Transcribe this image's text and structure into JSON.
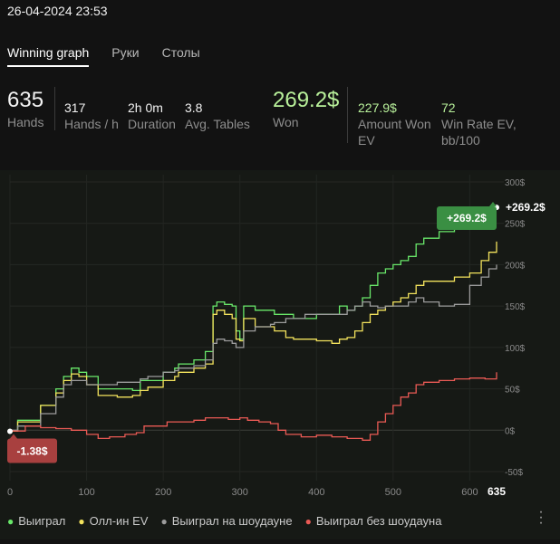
{
  "timestamp": "26-04-2024 23:53",
  "tabs": [
    {
      "label": "Winning graph",
      "active": true
    },
    {
      "label": "Руки",
      "active": false
    },
    {
      "label": "Столы",
      "active": false
    }
  ],
  "stats": {
    "hands": {
      "value": "635",
      "label": "Hands"
    },
    "hands_per_hour": {
      "value": "317",
      "label": "Hands / h"
    },
    "duration": {
      "value": "2h 0m",
      "label": "Duration"
    },
    "avg_tables": {
      "value": "3.8",
      "label": "Avg. Tables"
    },
    "won": {
      "value": "269.2$",
      "label": "Won"
    },
    "amount_won_ev": {
      "value": "227.9$",
      "label_line1": "Amount Won",
      "label_line2": "EV"
    },
    "win_rate_ev": {
      "value": "72",
      "label_line1": "Win Rate EV,",
      "label_line2": "bb/100"
    }
  },
  "colors": {
    "won": "#69e86a",
    "allin_ev": "#f3e35d",
    "showdown": "#9c9c9c",
    "non_showdown": "#ea5a55",
    "accent_green": "#b8f09a",
    "badge_green": "#3a8f43",
    "badge_red": "#a8403f"
  },
  "chart_data": {
    "type": "line",
    "x_ticks": [
      "0",
      "100",
      "200",
      "300",
      "400",
      "500",
      "600"
    ],
    "x_end_label": "635",
    "y_ticks": [
      "300$",
      "250$",
      "200$",
      "150$",
      "100$",
      "50$",
      "0$",
      "-50$"
    ],
    "xlim": [
      0,
      635
    ],
    "ylim": [
      -50,
      300
    ],
    "end_label": "+269.2$",
    "end_badge": "+269.2$",
    "min_badge": "-1.38$",
    "min_point": [
      0,
      -1.38
    ],
    "series": [
      {
        "key": "won",
        "name": "Выиграл",
        "color_key": "won",
        "points": [
          [
            0,
            -1
          ],
          [
            10,
            12
          ],
          [
            40,
            30
          ],
          [
            60,
            50
          ],
          [
            70,
            65
          ],
          [
            80,
            75
          ],
          [
            90,
            70
          ],
          [
            100,
            65
          ],
          [
            115,
            50
          ],
          [
            140,
            50
          ],
          [
            160,
            48
          ],
          [
            170,
            60
          ],
          [
            180,
            60
          ],
          [
            200,
            70
          ],
          [
            215,
            75
          ],
          [
            220,
            80
          ],
          [
            240,
            85
          ],
          [
            255,
            95
          ],
          [
            265,
            150
          ],
          [
            270,
            155
          ],
          [
            280,
            152
          ],
          [
            290,
            150
          ],
          [
            295,
            120
          ],
          [
            300,
            110
          ],
          [
            305,
            150
          ],
          [
            320,
            145
          ],
          [
            340,
            145
          ],
          [
            345,
            140
          ],
          [
            360,
            140
          ],
          [
            370,
            135
          ],
          [
            385,
            135
          ],
          [
            400,
            140
          ],
          [
            420,
            140
          ],
          [
            430,
            150
          ],
          [
            440,
            145
          ],
          [
            450,
            150
          ],
          [
            460,
            160
          ],
          [
            470,
            175
          ],
          [
            480,
            190
          ],
          [
            490,
            195
          ],
          [
            500,
            200
          ],
          [
            510,
            205
          ],
          [
            520,
            210
          ],
          [
            530,
            225
          ],
          [
            540,
            232
          ],
          [
            560,
            240
          ],
          [
            580,
            246
          ],
          [
            600,
            253
          ],
          [
            615,
            262
          ],
          [
            625,
            268
          ],
          [
            635,
            269.2
          ]
        ]
      },
      {
        "key": "allin_ev",
        "name": "Олл-ин EV",
        "color_key": "allin_ev",
        "points": [
          [
            0,
            -1
          ],
          [
            10,
            10
          ],
          [
            40,
            30
          ],
          [
            60,
            45
          ],
          [
            70,
            60
          ],
          [
            80,
            68
          ],
          [
            90,
            65
          ],
          [
            100,
            55
          ],
          [
            115,
            42
          ],
          [
            140,
            40
          ],
          [
            160,
            42
          ],
          [
            170,
            48
          ],
          [
            180,
            52
          ],
          [
            200,
            60
          ],
          [
            215,
            65
          ],
          [
            220,
            70
          ],
          [
            240,
            75
          ],
          [
            255,
            80
          ],
          [
            265,
            140
          ],
          [
            270,
            145
          ],
          [
            280,
            140
          ],
          [
            290,
            135
          ],
          [
            295,
            110
          ],
          [
            300,
            108
          ],
          [
            305,
            135
          ],
          [
            320,
            125
          ],
          [
            340,
            125
          ],
          [
            345,
            120
          ],
          [
            360,
            112
          ],
          [
            370,
            110
          ],
          [
            385,
            110
          ],
          [
            400,
            108
          ],
          [
            420,
            105
          ],
          [
            430,
            110
          ],
          [
            440,
            112
          ],
          [
            450,
            120
          ],
          [
            460,
            130
          ],
          [
            470,
            140
          ],
          [
            480,
            145
          ],
          [
            490,
            150
          ],
          [
            500,
            155
          ],
          [
            510,
            160
          ],
          [
            520,
            165
          ],
          [
            530,
            175
          ],
          [
            540,
            180
          ],
          [
            560,
            180
          ],
          [
            580,
            185
          ],
          [
            600,
            190
          ],
          [
            615,
            205
          ],
          [
            625,
            215
          ],
          [
            635,
            227.9
          ]
        ]
      },
      {
        "key": "showdown",
        "name": "Выиграл на шоудауне",
        "color_key": "showdown",
        "points": [
          [
            0,
            0
          ],
          [
            10,
            5
          ],
          [
            40,
            20
          ],
          [
            60,
            40
          ],
          [
            70,
            55
          ],
          [
            80,
            60
          ],
          [
            90,
            60
          ],
          [
            100,
            55
          ],
          [
            115,
            55
          ],
          [
            140,
            58
          ],
          [
            160,
            58
          ],
          [
            170,
            62
          ],
          [
            180,
            65
          ],
          [
            200,
            70
          ],
          [
            215,
            72
          ],
          [
            220,
            75
          ],
          [
            240,
            78
          ],
          [
            255,
            85
          ],
          [
            265,
            105
          ],
          [
            270,
            110
          ],
          [
            280,
            108
          ],
          [
            290,
            105
          ],
          [
            295,
            100
          ],
          [
            300,
            100
          ],
          [
            305,
            120
          ],
          [
            320,
            125
          ],
          [
            340,
            128
          ],
          [
            345,
            130
          ],
          [
            360,
            135
          ],
          [
            370,
            135
          ],
          [
            385,
            140
          ],
          [
            400,
            140
          ],
          [
            420,
            140
          ],
          [
            430,
            140
          ],
          [
            440,
            145
          ],
          [
            450,
            150
          ],
          [
            460,
            155
          ],
          [
            470,
            150
          ],
          [
            480,
            148
          ],
          [
            490,
            150
          ],
          [
            500,
            150
          ],
          [
            510,
            150
          ],
          [
            520,
            155
          ],
          [
            530,
            160
          ],
          [
            540,
            155
          ],
          [
            560,
            150
          ],
          [
            580,
            152
          ],
          [
            600,
            175
          ],
          [
            615,
            185
          ],
          [
            625,
            195
          ],
          [
            635,
            200
          ]
        ]
      },
      {
        "key": "non_showdown",
        "name": "Выиграл без шоудауна",
        "color_key": "non_showdown",
        "points": [
          [
            0,
            -1
          ],
          [
            20,
            5
          ],
          [
            40,
            3
          ],
          [
            60,
            2
          ],
          [
            80,
            0
          ],
          [
            100,
            -5
          ],
          [
            115,
            -10
          ],
          [
            130,
            -8
          ],
          [
            150,
            -5
          ],
          [
            165,
            -3
          ],
          [
            175,
            5
          ],
          [
            190,
            5
          ],
          [
            205,
            10
          ],
          [
            220,
            10
          ],
          [
            240,
            12
          ],
          [
            255,
            15
          ],
          [
            270,
            15
          ],
          [
            285,
            13
          ],
          [
            300,
            15
          ],
          [
            310,
            12
          ],
          [
            325,
            10
          ],
          [
            340,
            8
          ],
          [
            350,
            0
          ],
          [
            360,
            -5
          ],
          [
            380,
            -8
          ],
          [
            400,
            -6
          ],
          [
            420,
            -8
          ],
          [
            440,
            -10
          ],
          [
            460,
            -12
          ],
          [
            470,
            -5
          ],
          [
            480,
            10
          ],
          [
            490,
            20
          ],
          [
            500,
            30
          ],
          [
            510,
            40
          ],
          [
            520,
            45
          ],
          [
            530,
            55
          ],
          [
            540,
            58
          ],
          [
            560,
            60
          ],
          [
            580,
            62
          ],
          [
            600,
            63
          ],
          [
            620,
            62
          ],
          [
            635,
            70
          ]
        ]
      }
    ]
  }
}
